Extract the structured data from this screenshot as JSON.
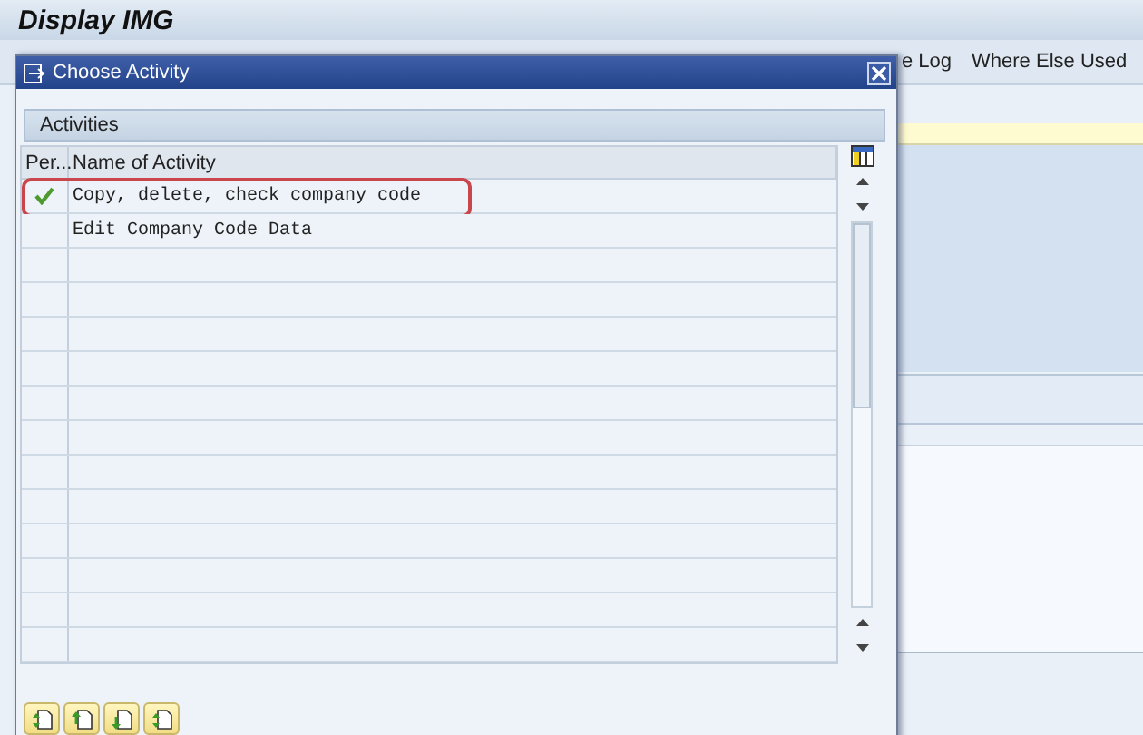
{
  "window": {
    "title": "Display IMG"
  },
  "toolbar": {
    "items": [
      "e Log",
      "Where Else Used"
    ]
  },
  "dialog": {
    "title": "Choose Activity",
    "panel_title": "Activities",
    "columns": [
      "Per...",
      "Name of Activity"
    ],
    "rows": [
      {
        "done": true,
        "name": "Copy, delete, check company code",
        "highlighted": true
      },
      {
        "done": false,
        "name": "Edit Company Code Data",
        "highlighted": false
      }
    ]
  }
}
